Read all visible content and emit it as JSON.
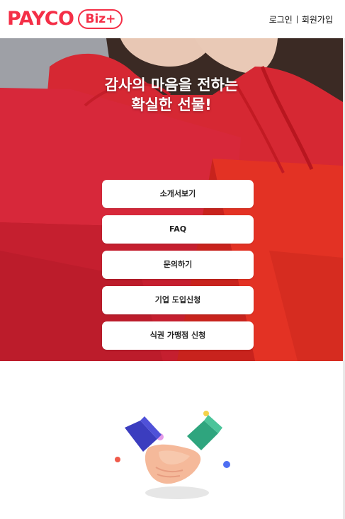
{
  "header": {
    "logo": {
      "text": "PAYCO",
      "badge": "Biz+"
    },
    "links": {
      "login": "로그인",
      "signup": "회원가입"
    }
  },
  "hero": {
    "title_line1": "감사의 마음을 전하는",
    "title_line2": "확실한 선물!",
    "menu": [
      {
        "label": "소개서보기"
      },
      {
        "label": "FAQ"
      },
      {
        "label": "문의하기"
      },
      {
        "label": "기업 도입신청"
      },
      {
        "label": "식권 가맹점 신청"
      }
    ]
  },
  "colors": {
    "brand": "#f42f47",
    "hero_red": "#c71f28",
    "button_bg": "#ffffff",
    "text_dark": "#222222"
  },
  "icons": {
    "lower_illustration": "handshake-icon"
  }
}
